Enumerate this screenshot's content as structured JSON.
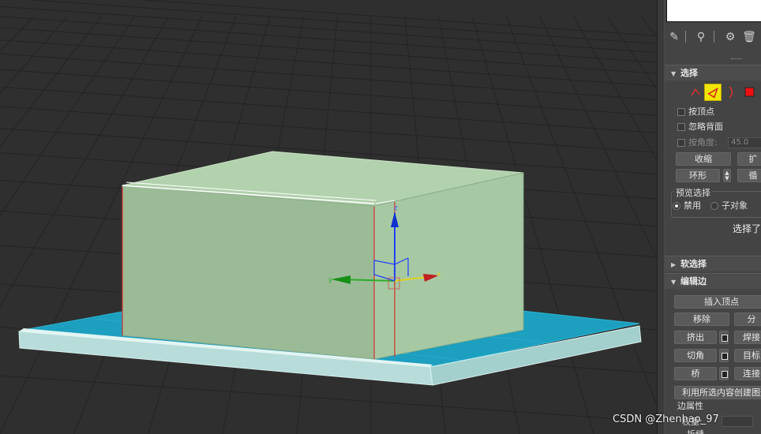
{
  "viewport": {
    "gizmo": {
      "x_label": "x",
      "y_label": "y",
      "z_label": "z"
    }
  },
  "panel": {
    "modifier_tools": [
      "pin-stack-icon",
      "show-end-result-icon",
      "make-unique-icon",
      "remove-modifier-icon"
    ],
    "selection": {
      "title": "选择",
      "by_vertex": "按顶点",
      "ignore_backfacing": "忽略背面",
      "by_angle": "按角度:",
      "angle_value": "45.0",
      "shrink": "收缩",
      "grow": "扩",
      "ring": "环形",
      "loop": "循",
      "preview": {
        "title": "预览选择",
        "off": "禁用",
        "subobject": "子对象"
      },
      "status": "选择了"
    },
    "soft_selection": {
      "title": "软选择"
    },
    "edit_edges": {
      "title": "编辑边",
      "insert_vertex": "插入顶点",
      "remove": "移除",
      "split": "分",
      "extrude": "挤出",
      "weld": "焊接",
      "chamfer": "切角",
      "target_weld": "目标",
      "bridge": "桥",
      "connect": "连接",
      "create_shape": "利用所选内容创建图形",
      "edge_properties": "边属性",
      "weight": "权重:",
      "crease": "折缝"
    }
  },
  "watermark": "CSDN @Zhenhao_97",
  "colors": {
    "box_front": "#9bbb97",
    "box_side": "#a6c9a3",
    "box_top": "#b2d1ad",
    "plate": "#1d9fbf",
    "rim": "#b7dcd9",
    "panel_bg": "#444444",
    "active_tool": "#f2e600"
  }
}
